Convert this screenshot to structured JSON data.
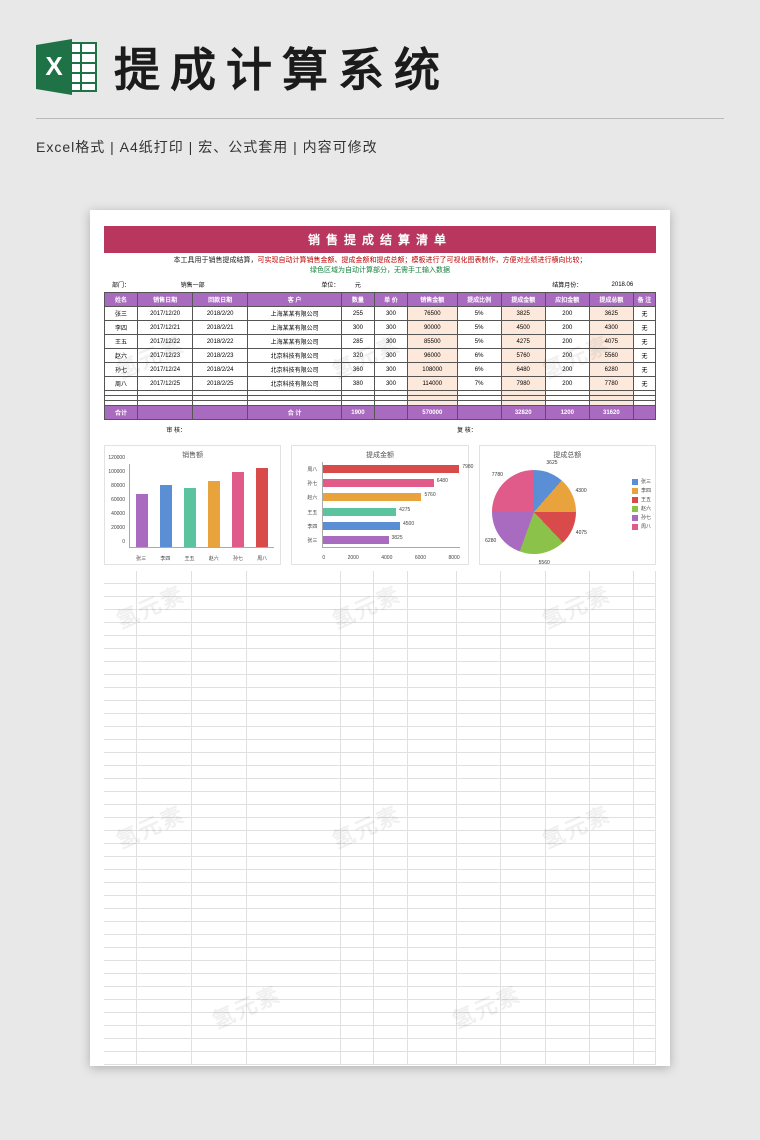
{
  "header": {
    "page_title": "提成计算系统",
    "subhead": "Excel格式 |  A4纸打印 |  宏、公式套用 |  内容可修改"
  },
  "doc": {
    "title": "销售提成结算清单",
    "desc_red_left": "本工具用于销售提成结算，",
    "desc_red_mid": "可实现自动计算销售金额、提成金额和提成总额；模板进行了可视化图表制作，方便对业绩进行横向比较；",
    "desc_black": "绿色区域为自动计算部分，无需手工输入数据",
    "ctx": {
      "dept_lbl": "部门：",
      "dept_val": "销售一部",
      "unit_lbl": "单位：",
      "unit_val": "元",
      "month_lbl": "结算月份：",
      "month_val": "2018.06"
    },
    "headers": [
      "姓名",
      "销售日期",
      "回款日期",
      "客 户",
      "数量",
      "单 价",
      "销售金额",
      "提成比例",
      "提成金额",
      "应扣金额",
      "提成总额",
      "备 注"
    ],
    "rows": [
      {
        "name": "张三",
        "d1": "2017/12/20",
        "d2": "2018/2/20",
        "cust": "上海某某有限公司",
        "qty": "255",
        "price": "300",
        "amt": "76500",
        "rate": "5%",
        "comm": "3825",
        "ded": "200",
        "tot": "3625",
        "note": "无"
      },
      {
        "name": "李四",
        "d1": "2017/12/21",
        "d2": "2018/2/21",
        "cust": "上海某某有限公司",
        "qty": "300",
        "price": "300",
        "amt": "90000",
        "rate": "5%",
        "comm": "4500",
        "ded": "200",
        "tot": "4300",
        "note": "无"
      },
      {
        "name": "王五",
        "d1": "2017/12/22",
        "d2": "2018/2/22",
        "cust": "上海某某有限公司",
        "qty": "285",
        "price": "300",
        "amt": "85500",
        "rate": "5%",
        "comm": "4275",
        "ded": "200",
        "tot": "4075",
        "note": "无"
      },
      {
        "name": "赵六",
        "d1": "2017/12/23",
        "d2": "2018/2/23",
        "cust": "北京科技有限公司",
        "qty": "320",
        "price": "300",
        "amt": "96000",
        "rate": "6%",
        "comm": "5760",
        "ded": "200",
        "tot": "5560",
        "note": "无"
      },
      {
        "name": "孙七",
        "d1": "2017/12/24",
        "d2": "2018/2/24",
        "cust": "北京科技有限公司",
        "qty": "360",
        "price": "300",
        "amt": "108000",
        "rate": "6%",
        "comm": "6480",
        "ded": "200",
        "tot": "6280",
        "note": "无"
      },
      {
        "name": "周八",
        "d1": "2017/12/25",
        "d2": "2018/2/25",
        "cust": "北京科技有限公司",
        "qty": "380",
        "price": "300",
        "amt": "114000",
        "rate": "7%",
        "comm": "7980",
        "ded": "200",
        "tot": "7780",
        "note": "无"
      }
    ],
    "sum": {
      "lbl": "合计",
      "qty": "1900",
      "amt": "570000",
      "comm": "32820",
      "ded": "1200",
      "tot": "31620",
      "mid": "合  计"
    },
    "sign": {
      "audit": "审  核：",
      "recheck": "复  核："
    }
  },
  "chart_data": [
    {
      "type": "bar",
      "title": "销售额",
      "categories": [
        "张三",
        "李四",
        "王五",
        "赵六",
        "孙七",
        "周八"
      ],
      "values": [
        76500,
        90000,
        85500,
        96000,
        108000,
        114000
      ],
      "ylim": [
        0,
        120000
      ],
      "yticks": [
        0,
        20000,
        40000,
        60000,
        80000,
        100000,
        120000
      ],
      "colors": [
        "#a96bbf",
        "#5a8fd6",
        "#5bc49f",
        "#e8a33d",
        "#e05a8a",
        "#d94b4b"
      ]
    },
    {
      "type": "bar_h",
      "title": "提成金额",
      "categories": [
        "周八",
        "孙七",
        "赵六",
        "王五",
        "李四",
        "张三"
      ],
      "values": [
        7980,
        6480,
        5760,
        4275,
        4500,
        3825
      ],
      "xlim": [
        0,
        8000
      ],
      "xticks": [
        0,
        2000,
        4000,
        6000,
        8000
      ],
      "colors": [
        "#d94b4b",
        "#e05a8a",
        "#e8a33d",
        "#5bc49f",
        "#5a8fd6",
        "#a96bbf"
      ]
    },
    {
      "type": "pie",
      "title": "提成总额",
      "categories": [
        "张三",
        "李四",
        "王五",
        "赵六",
        "孙七",
        "周八"
      ],
      "values": [
        3625,
        4300,
        4075,
        5560,
        6280,
        7780
      ],
      "colors": [
        "#5a8fd6",
        "#e8a33d",
        "#d94b4b",
        "#8bc34a",
        "#a96bbf",
        "#e05a8a"
      ]
    }
  ],
  "watermark": "氢元素"
}
